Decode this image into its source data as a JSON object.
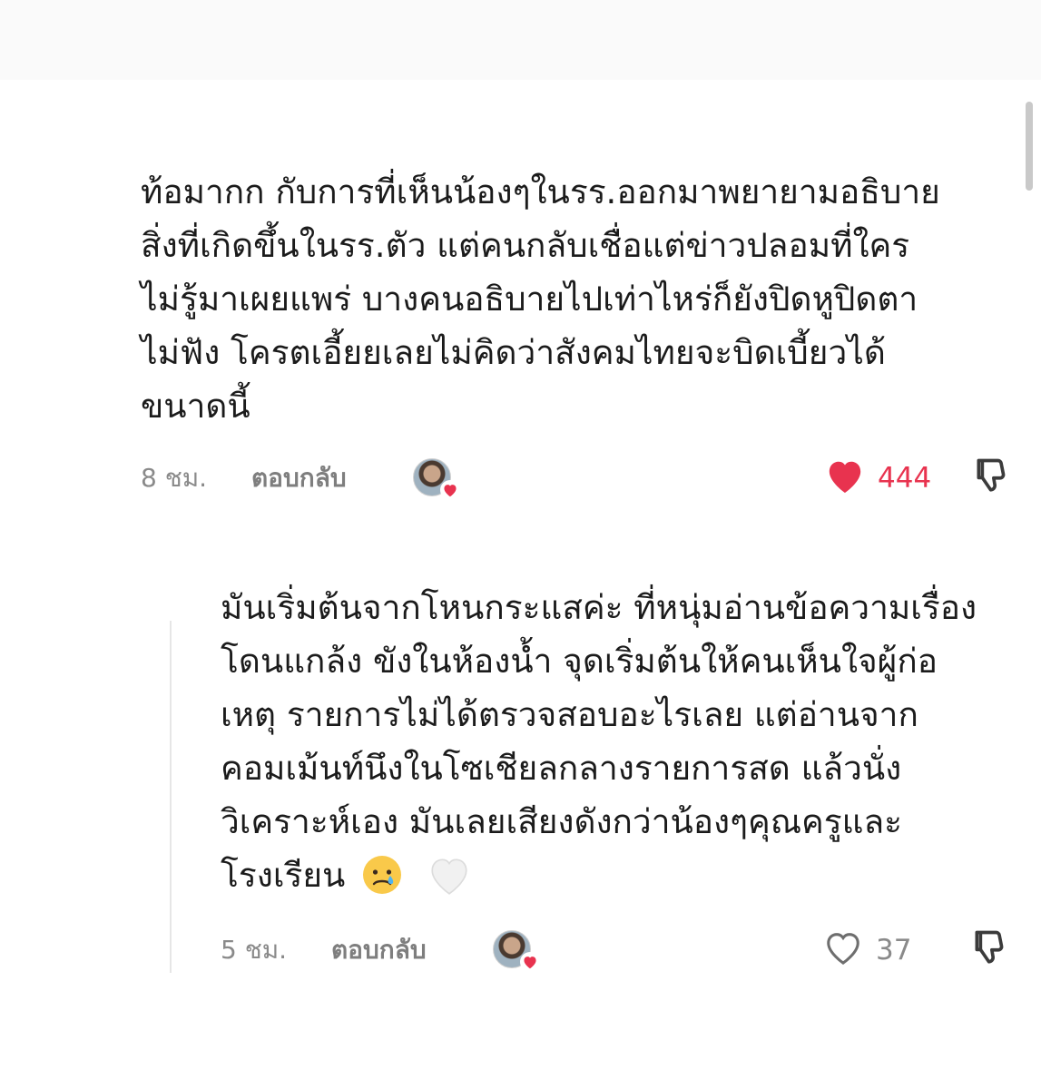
{
  "colors": {
    "like_active": "#e8334f",
    "muted_text": "#8a8a8a",
    "body_text": "#1b1b1b"
  },
  "comments": [
    {
      "text_lines": [
        "ท้อมากก กับการที่เห็นน้องๆในรร.ออกมาพยายามอธิบาย",
        "สิ่งที่เกิดขึ้นในรร.ตัว แต่คนกลับเชื่อแต่ข่าวปลอมที่ใคร",
        "ไม่รู้มาเผยแพร่ บางคนอธิบายไปเท่าไหร่ก็ยังปิดหูปิดตา",
        "ไม่ฟัง โครตเอี้ยยเลยไม่คิดว่าสังคมไทยจะบิดเบี้ยวได้",
        "ขนาดนี้"
      ],
      "time": "8 ชม.",
      "reply_label": "ตอบกลับ",
      "like_count": "444",
      "liked": true,
      "icons": [
        "creator-avatar-icon",
        "heart-filled-icon",
        "thumbs-down-icon"
      ]
    },
    {
      "text_lines": [
        "มันเริ่มต้นจากโหนกระแสค่ะ ที่หนุ่มอ่านข้อความเรื่อง",
        "โดนแกล้ง ขังในห้องน้ำ จุดเริ่มต้นให้คนเห็นใจผู้ก่อ",
        "เหตุ รายการไม่ได้ตรวจสอบอะไรเลย แต่อ่านจาก",
        "คอมเม้นท์นึงในโซเชียลกลางรายการสด แล้วนั่ง",
        "วิเคราะห์เอง มันเลยเสียงดังกว่าน้องๆคุณครูและ",
        "โรงเรียน"
      ],
      "emojis": [
        "crying-face-icon",
        "white-heart-icon"
      ],
      "time": "5 ชม.",
      "reply_label": "ตอบกลับ",
      "like_count": "37",
      "liked": false,
      "icons": [
        "creator-avatar-icon",
        "heart-outline-icon",
        "thumbs-down-icon"
      ]
    }
  ]
}
